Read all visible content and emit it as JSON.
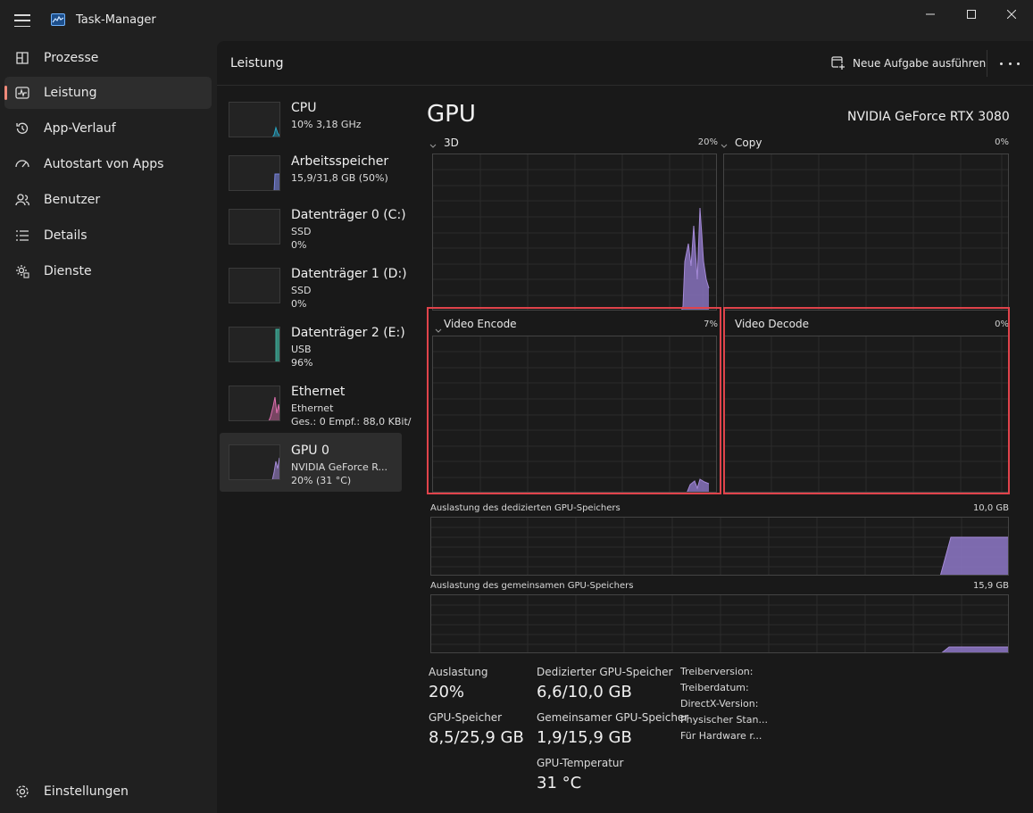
{
  "window": {
    "title": "Task-Manager"
  },
  "sidebar": {
    "items": [
      {
        "label": "Prozesse",
        "icon": "processes-icon"
      },
      {
        "label": "Leistung",
        "icon": "performance-icon"
      },
      {
        "label": "App-Verlauf",
        "icon": "history-icon"
      },
      {
        "label": "Autostart von Apps",
        "icon": "startup-icon"
      },
      {
        "label": "Benutzer",
        "icon": "users-icon"
      },
      {
        "label": "Details",
        "icon": "details-icon"
      },
      {
        "label": "Dienste",
        "icon": "services-icon"
      }
    ],
    "active_index": 1,
    "settings_label": "Einstellungen"
  },
  "header": {
    "title": "Leistung",
    "new_task_label": "Neue Aufgabe ausführen"
  },
  "devices": [
    {
      "name": "CPU",
      "line1": "10% 3,18 GHz",
      "line2": "",
      "color": "#29a8c8"
    },
    {
      "name": "Arbeitsspeicher",
      "line1": "15,9/31,8 GB (50%)",
      "line2": "",
      "color": "#7a86e0"
    },
    {
      "name": "Datenträger 0 (C:)",
      "line1": "SSD",
      "line2": "0%",
      "color": "#3fb29c"
    },
    {
      "name": "Datenträger 1 (D:)",
      "line1": "SSD",
      "line2": "0%",
      "color": "#3fb29c"
    },
    {
      "name": "Datenträger 2 (E:)",
      "line1": "USB",
      "line2": "96%",
      "color": "#3fb29c"
    },
    {
      "name": "Ethernet",
      "line1": "Ethernet",
      "line2": "Ges.: 0 Empf.: 88,0 KBit/",
      "color": "#e06fb0"
    },
    {
      "name": "GPU 0",
      "line1": "NVIDIA GeForce R...",
      "line2": "20% (31 °C)",
      "color": "#a58ad8"
    }
  ],
  "active_device_index": 6,
  "gpu": {
    "title": "GPU",
    "model": "NVIDIA GeForce RTX 3080",
    "engines": [
      {
        "name": "3D",
        "percent": "20%"
      },
      {
        "name": "Copy",
        "percent": "0%"
      },
      {
        "name": "Video Encode",
        "percent": "7%"
      },
      {
        "name": "Video Decode",
        "percent": "0%"
      }
    ],
    "memory_graphs": [
      {
        "label": "Auslastung des dedizierten GPU-Speichers",
        "max": "10,0 GB"
      },
      {
        "label": "Auslastung des gemeinsamen GPU-Speichers",
        "max": "15,9 GB"
      }
    ],
    "stats": {
      "utilization_label": "Auslastung",
      "utilization": "20%",
      "gpu_memory_label": "GPU-Speicher",
      "gpu_memory": "8,5/25,9 GB",
      "dedicated_label": "Dedizierter GPU-Speicher",
      "dedicated": "6,6/10,0 GB",
      "shared_label": "Gemeinsamer GPU-Speicher",
      "shared": "1,9/15,9 GB",
      "temp_label": "GPU-Temperatur",
      "temp": "31 °C"
    },
    "info_labels": [
      "Treiberversion:",
      "Treiberdatum:",
      "DirectX-Version:",
      "Physischer Stan...",
      "Für Hardware r..."
    ]
  },
  "colors": {
    "gpu_fill": "#8e78c8",
    "highlight": "#e0434b",
    "accent": "#f08a7a"
  }
}
